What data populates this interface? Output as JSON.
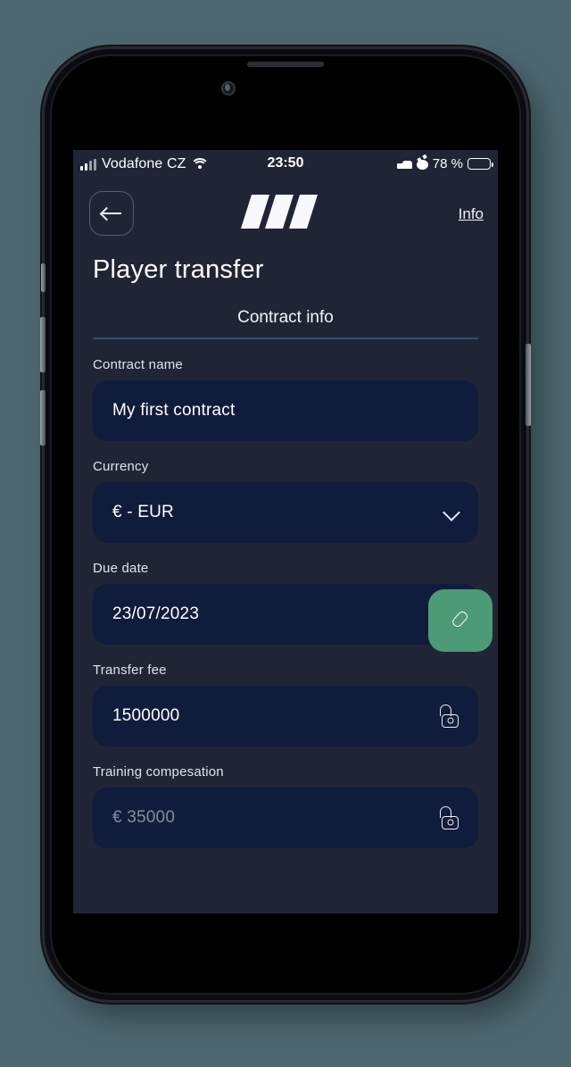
{
  "status_bar": {
    "carrier": "Vodafone CZ",
    "time": "23:50",
    "battery_percent": "78 %",
    "icons": [
      "signal-bars-icon",
      "wifi-icon",
      "bed-icon",
      "alarm-clock-icon",
      "battery-icon"
    ]
  },
  "header": {
    "back_icon": "arrow-left-icon",
    "logo": "brand-logo-icon",
    "info_label": "Info"
  },
  "page": {
    "title": "Player transfer"
  },
  "tabs": [
    {
      "label": "Contract info",
      "active": true
    }
  ],
  "form": {
    "fields": [
      {
        "label": "Contract name",
        "value": "My first contract",
        "placeholder": "",
        "is_placeholder": false,
        "trailing_icon": "none"
      },
      {
        "label": "Currency",
        "value": "€ - EUR",
        "placeholder": "",
        "is_placeholder": false,
        "trailing_icon": "chevron-down-icon"
      },
      {
        "label": "Due date",
        "value": "23/07/2023",
        "placeholder": "",
        "is_placeholder": false,
        "trailing_icon": "lock-open-icon"
      },
      {
        "label": "Transfer fee",
        "value": "1500000",
        "placeholder": "",
        "is_placeholder": false,
        "trailing_icon": "lock-open-icon"
      },
      {
        "label": "Training compesation",
        "value": "€ 35000",
        "placeholder": "€ 35000",
        "is_placeholder": true,
        "trailing_icon": "lock-open-icon"
      }
    ]
  },
  "fab": {
    "icon": "pencil-edit-icon"
  },
  "colors": {
    "page_background": "#4d6771",
    "app_background": "#202536",
    "input_background": "#101c3b",
    "accent_green": "#4d9a76",
    "divider": "#3b4a6e",
    "text_primary": "#ffffff",
    "text_muted": "#838b9e"
  }
}
